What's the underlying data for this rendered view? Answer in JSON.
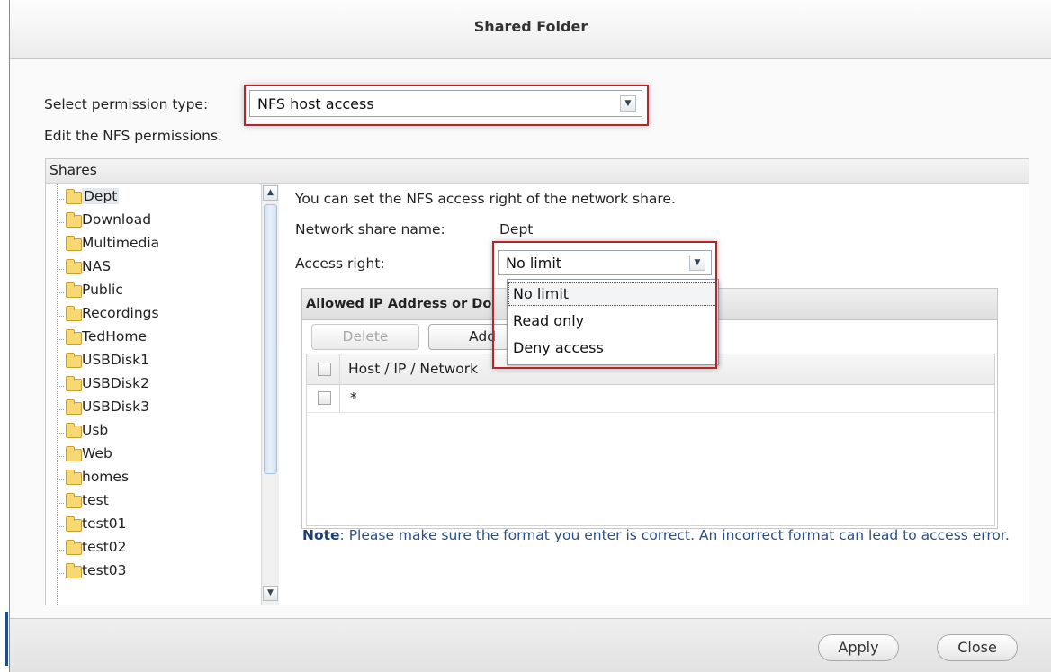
{
  "window": {
    "title": "Shared Folder"
  },
  "permission": {
    "label": "Select permission type:",
    "selected": "NFS host access",
    "description": "Edit the NFS permissions."
  },
  "shares": {
    "header": "Shares",
    "items": [
      "Dept",
      "Download",
      "Multimedia",
      "NAS",
      "Public",
      "Recordings",
      "TedHome",
      "USBDisk1",
      "USBDisk2",
      "USBDisk3",
      "Usb",
      "Web",
      "homes",
      "test",
      "test01",
      "test02",
      "test03"
    ],
    "selected": "Dept"
  },
  "nfs": {
    "intro": "You can set the NFS access right of the network share.",
    "share_name_label": "Network share name:",
    "share_name_value": "Dept",
    "access_right_label": "Access right:",
    "access_right_value": "No limit",
    "access_options": [
      "No limit",
      "Read only",
      "Deny access"
    ]
  },
  "allowed": {
    "header": "Allowed IP Address or Do",
    "delete_label": "Delete",
    "add_label": "Add",
    "column_host": "Host / IP / Network",
    "rows": [
      "*"
    ]
  },
  "note": {
    "bold": "Note",
    "text": ": Please make sure the format you enter is correct. An incorrect format can lead to access error."
  },
  "footer": {
    "apply_label": "Apply",
    "close_label": "Close"
  },
  "colors": {
    "highlight": "#b3262c",
    "note_text": "#2b4f86",
    "folder": "#f6d874"
  }
}
